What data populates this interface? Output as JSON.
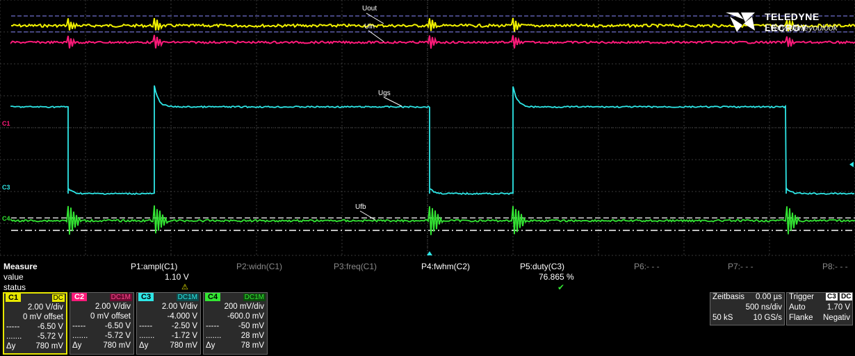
{
  "brand": {
    "name": "TELEDYNE LECROY",
    "tagline": "Everywhereyoulook"
  },
  "traces": {
    "uout": {
      "label": "Uout",
      "color": "#f2f200"
    },
    "uin": {
      "label": "Uin",
      "color": "#ff1a7a"
    },
    "ugs": {
      "label": "Ugs",
      "color": "#2ee6e6"
    },
    "ufb": {
      "label": "Ufb",
      "color": "#33e633"
    }
  },
  "channel_markers": {
    "c1": "C1",
    "c3": "C3",
    "c4": "C4"
  },
  "measure": {
    "title": "Measure",
    "row_value": "value",
    "row_status": "status",
    "params": [
      {
        "name": "P1:ampl(C1)",
        "value": "1.10 V",
        "status": "⚠",
        "active": true
      },
      {
        "name": "P2:widn(C1)",
        "value": "",
        "status": "",
        "active": false
      },
      {
        "name": "P3:freq(C1)",
        "value": "",
        "status": "",
        "active": false
      },
      {
        "name": "P4:fwhm(C2)",
        "value": "",
        "status": "",
        "active": true
      },
      {
        "name": "P5:duty(C3)",
        "value": "76.865 %",
        "status": "✔",
        "active": true
      },
      {
        "name": "P6:- - -",
        "value": "",
        "status": "",
        "active": false
      },
      {
        "name": "P7:- - -",
        "value": "",
        "status": "",
        "active": false
      },
      {
        "name": "P8:- - -",
        "value": "",
        "status": "",
        "active": false
      }
    ]
  },
  "channels": [
    {
      "name": "C1",
      "coupling": "DC",
      "color": "#e8e800",
      "vdiv": "2.00 V/div",
      "offset": "0 mV offset",
      "cur1": "-6.50 V",
      "cur2": "-5.72 V",
      "dy": "780 mV"
    },
    {
      "name": "C2",
      "coupling": "DC1M",
      "color": "#ff1a7a",
      "vdiv": "2.00 V/div",
      "offset": "0 mV offset",
      "cur1": "-6.50 V",
      "cur2": "-5.72 V",
      "dy": "780 mV"
    },
    {
      "name": "C3",
      "coupling": "DC1M",
      "color": "#2ee6e6",
      "vdiv": "2.00 V/div",
      "offset": "-4.000 V",
      "cur1": "-2.50 V",
      "cur2": "-1.72 V",
      "dy": "780 mV"
    },
    {
      "name": "C4",
      "coupling": "DC1M",
      "color": "#33e633",
      "vdiv": "200 mV/div",
      "offset": "-600.0 mV",
      "cur1": "-50 mV",
      "cur2": "28 mV",
      "dy": "78 mV"
    }
  ],
  "cursor_label1": "-----",
  "cursor_label2": ".......",
  "dy_label": "Δy",
  "timebase": {
    "label": "Zeitbasis",
    "delay": "0.00 µs",
    "tdiv": "500 ns/div",
    "samples": "50 kS",
    "rate": "10 GS/s"
  },
  "trigger": {
    "label": "Trigger",
    "channel": "C3",
    "coupling": "DC",
    "mode": "Auto",
    "level": "1.70 V",
    "type": "Flanke",
    "slope": "Negativ"
  }
}
